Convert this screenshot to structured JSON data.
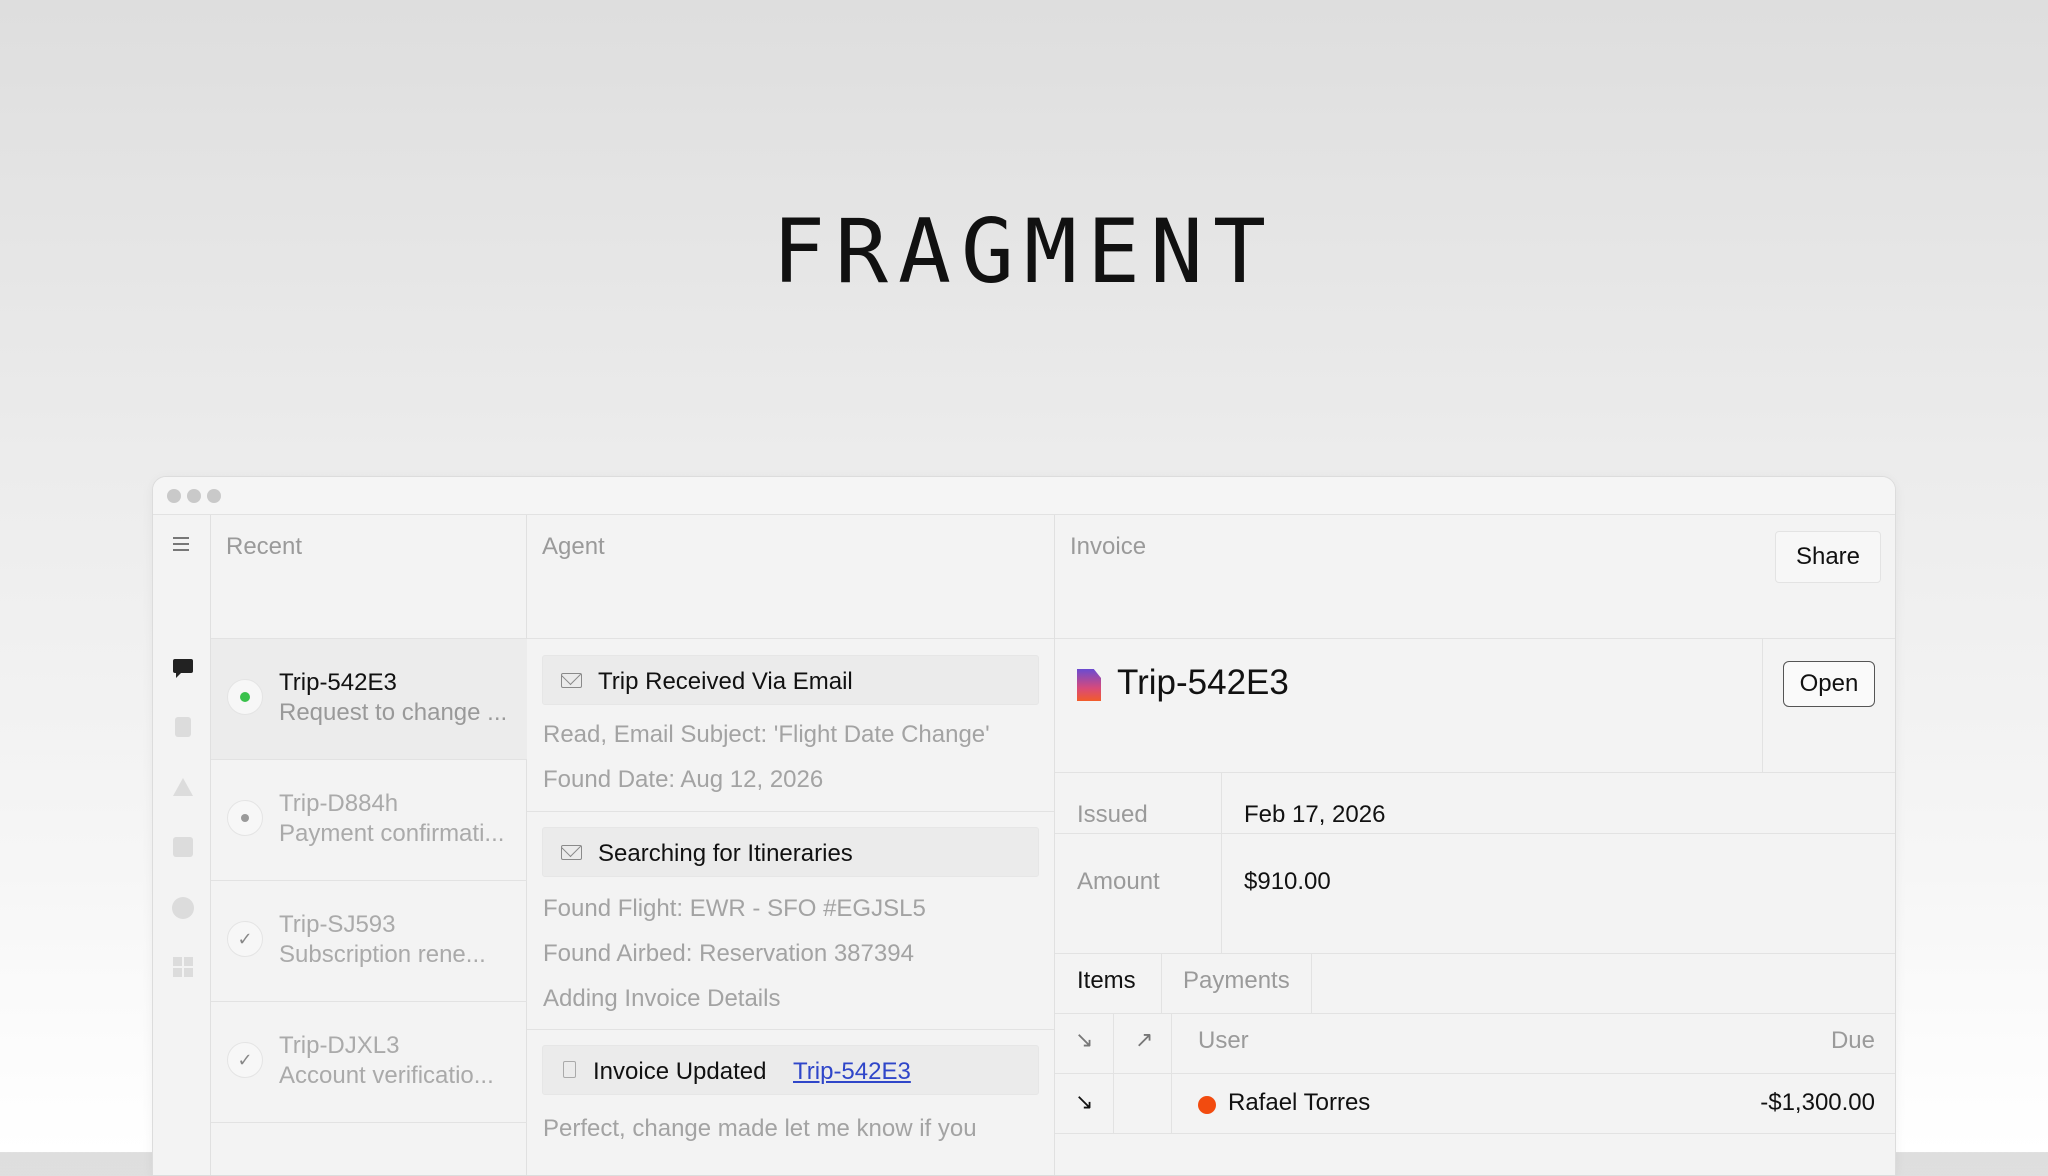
{
  "brand": "FRAGMENT",
  "columns": {
    "recent": "Recent",
    "agent": "Agent",
    "invoice": "Invoice"
  },
  "recent_items": [
    {
      "name": "Trip-542E3",
      "desc": "Request to change ...",
      "status": "active"
    },
    {
      "name": "Trip-D884h",
      "desc": "Payment confirmati...",
      "status": "pending"
    },
    {
      "name": "Trip-SJ593",
      "desc": "Subscription rene...",
      "status": "done"
    },
    {
      "name": "Trip-DJXL3",
      "desc": "Account verificatio...",
      "status": "done"
    }
  ],
  "agent": {
    "step1": {
      "label": "Trip Received Via Email",
      "lines": [
        "Read, Email Subject: 'Flight Date Change'",
        "Found Date: Aug 12, 2026"
      ]
    },
    "step2": {
      "label": "Searching for Itineraries",
      "lines": [
        "Found Flight: EWR - SFO #EGJSL5",
        "Found Airbed: Reservation 387394",
        "Adding Invoice Details"
      ]
    },
    "step3": {
      "label": "Invoice Updated",
      "link": "Trip-542E3"
    },
    "message": "Perfect, change made let me know if you"
  },
  "invoice": {
    "share_label": "Share",
    "title": "Trip-542E3",
    "open_label": "Open",
    "issued_label": "Issued",
    "issued_value": "Feb 17, 2026",
    "amount_label": "Amount",
    "amount_value": "$910.00",
    "tabs": [
      "Items",
      "Payments"
    ],
    "table": {
      "headers": {
        "user": "User",
        "due": "Due"
      },
      "rows": [
        {
          "user": "Rafael Torres",
          "due": "-$1,300.00",
          "dot_color": "#f24b0f"
        }
      ]
    }
  },
  "colors": {
    "accent_link": "#2f46c9",
    "status_green": "#39c14b",
    "user_dot": "#f24b0f"
  }
}
